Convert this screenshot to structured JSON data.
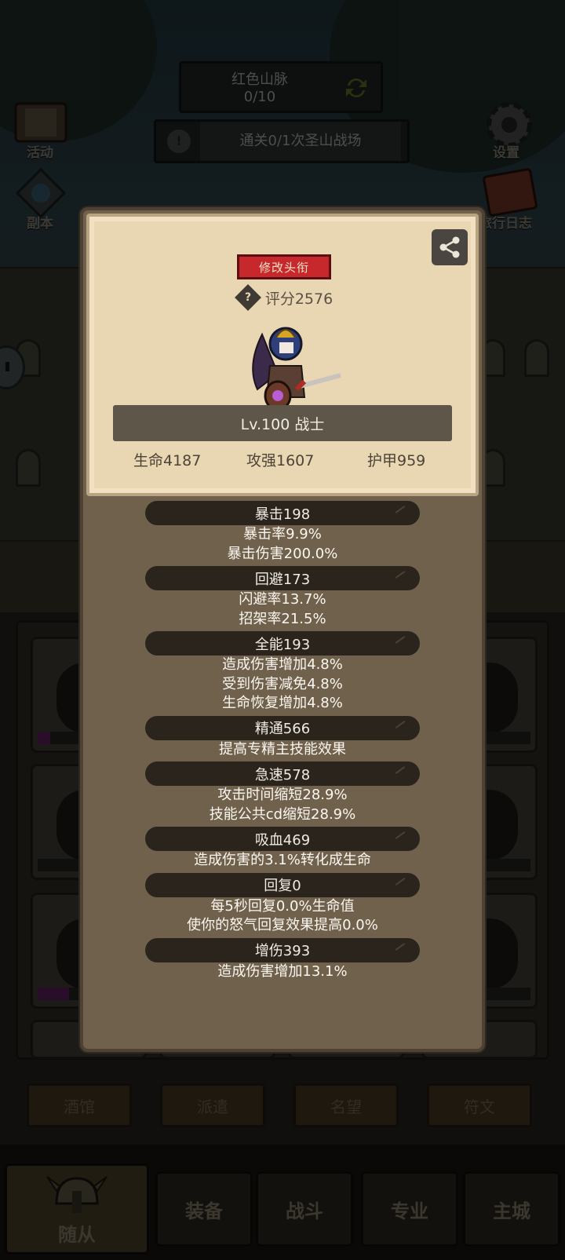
{
  "hud": {
    "region_name": "红色山脉",
    "region_progress": "0/10",
    "quest_text": "通关0/1次圣山战场"
  },
  "corner_buttons": {
    "activity_label": "活动",
    "dungeon_label": "副本",
    "settings_label": "设置",
    "journal_label": "旅行日志"
  },
  "modal": {
    "edit_title_label": "修改头衔",
    "score_text": "评分2576",
    "level_class_text": "Lv.100 战士",
    "hp_text": "生命4187",
    "attack_text": "攻强1607",
    "armor_text": "护甲959",
    "stat_groups": [
      {
        "header": "暴击198",
        "lines": [
          "暴击率9.9%",
          "暴击伤害200.0%"
        ]
      },
      {
        "header": "回避173",
        "lines": [
          "闪避率13.7%",
          "招架率21.5%"
        ]
      },
      {
        "header": "全能193",
        "lines": [
          "造成伤害增加4.8%",
          "受到伤害减免4.8%",
          "生命恢复增加4.8%"
        ]
      },
      {
        "header": "精通566",
        "lines": [
          "提高专精主技能效果"
        ]
      },
      {
        "header": "急速578",
        "lines": [
          "攻击时间缩短28.9%",
          "技能公共cd缩短28.9%"
        ]
      },
      {
        "header": "吸血469",
        "lines": [
          "造成伤害的3.1%转化成生命"
        ]
      },
      {
        "header": "回复0",
        "lines": [
          "每5秒回复0.0%生命值",
          "使你的怒气回复效果提高0.0%"
        ]
      },
      {
        "header": "增伤393",
        "lines": [
          "造成伤害增加13.1%"
        ]
      }
    ]
  },
  "sub_tabs": [
    "酒馆",
    "派遣",
    "名望",
    "符文"
  ],
  "nav_tabs": {
    "followers": "随从",
    "equipment": "装备",
    "battle": "战斗",
    "profession": "专业",
    "main_city": "主城"
  },
  "colors": {
    "modal_bg": "#70614d",
    "card_bg": "#e9d7b4",
    "edit_button": "#c7282b",
    "stat_pill": "#2b241c"
  }
}
